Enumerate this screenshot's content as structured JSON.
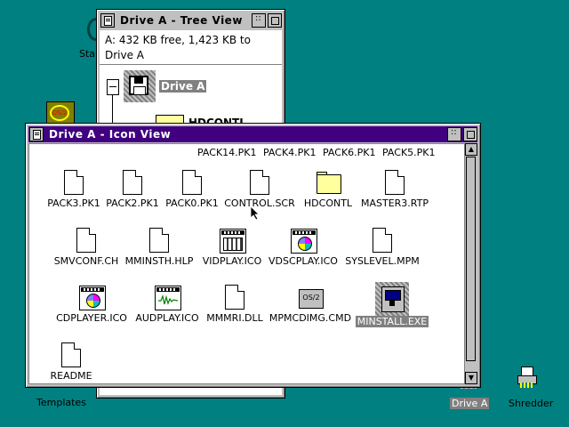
{
  "desktop": {
    "icons": [
      {
        "label": "Start"
      },
      {
        "label": "Templates"
      },
      {
        "label": "Drive A"
      },
      {
        "label": "Shredder"
      }
    ]
  },
  "tree_window": {
    "title": "Drive A - Tree View",
    "info_line1": "A:  432 KB free,  1,423 KB to",
    "info_line2": "Drive A",
    "root_label": "Drive A",
    "child_label": "HDCONTL"
  },
  "icon_window": {
    "title": "Drive A - Icon View",
    "top_row": [
      "PACK14.PK1",
      "PACK4.PK1",
      "PACK6.PK1",
      "PACK5.PK1"
    ],
    "items": [
      {
        "label": "PACK3.PK1",
        "icon": "document-icon"
      },
      {
        "label": "PACK2.PK1",
        "icon": "document-icon"
      },
      {
        "label": "PACK0.PK1",
        "icon": "document-icon"
      },
      {
        "label": "CONTROL.SCR",
        "icon": "document-icon"
      },
      {
        "label": "HDCONTL",
        "icon": "folder-icon"
      },
      {
        "label": "MASTER3.RTP",
        "icon": "document-icon"
      },
      {
        "label": "SMVCONF.CH",
        "icon": "document-icon"
      },
      {
        "label": "MMINSTH.HLP",
        "icon": "document-icon"
      },
      {
        "label": "VIDPLAY.ICO",
        "icon": "video-player-icon"
      },
      {
        "label": "VDSCPLAY.ICO",
        "icon": "videodisc-player-icon"
      },
      {
        "label": "SYSLEVEL.MPM",
        "icon": "document-icon"
      },
      {
        "label": "CDPLAYER.ICO",
        "icon": "cd-player-icon"
      },
      {
        "label": "AUDPLAY.ICO",
        "icon": "audio-player-icon"
      },
      {
        "label": "MMMRI.DLL",
        "icon": "document-icon"
      },
      {
        "label": "MPMCDIMG.CMD",
        "icon": "os2-command-icon"
      },
      {
        "label": "MINSTALL.EXE",
        "icon": "install-program-icon"
      },
      {
        "label": "README",
        "icon": "document-icon"
      }
    ],
    "os2_text": "OS/2"
  },
  "colors": {
    "desktop": "#008080",
    "active_title": "#400080",
    "selection": "#808080"
  }
}
